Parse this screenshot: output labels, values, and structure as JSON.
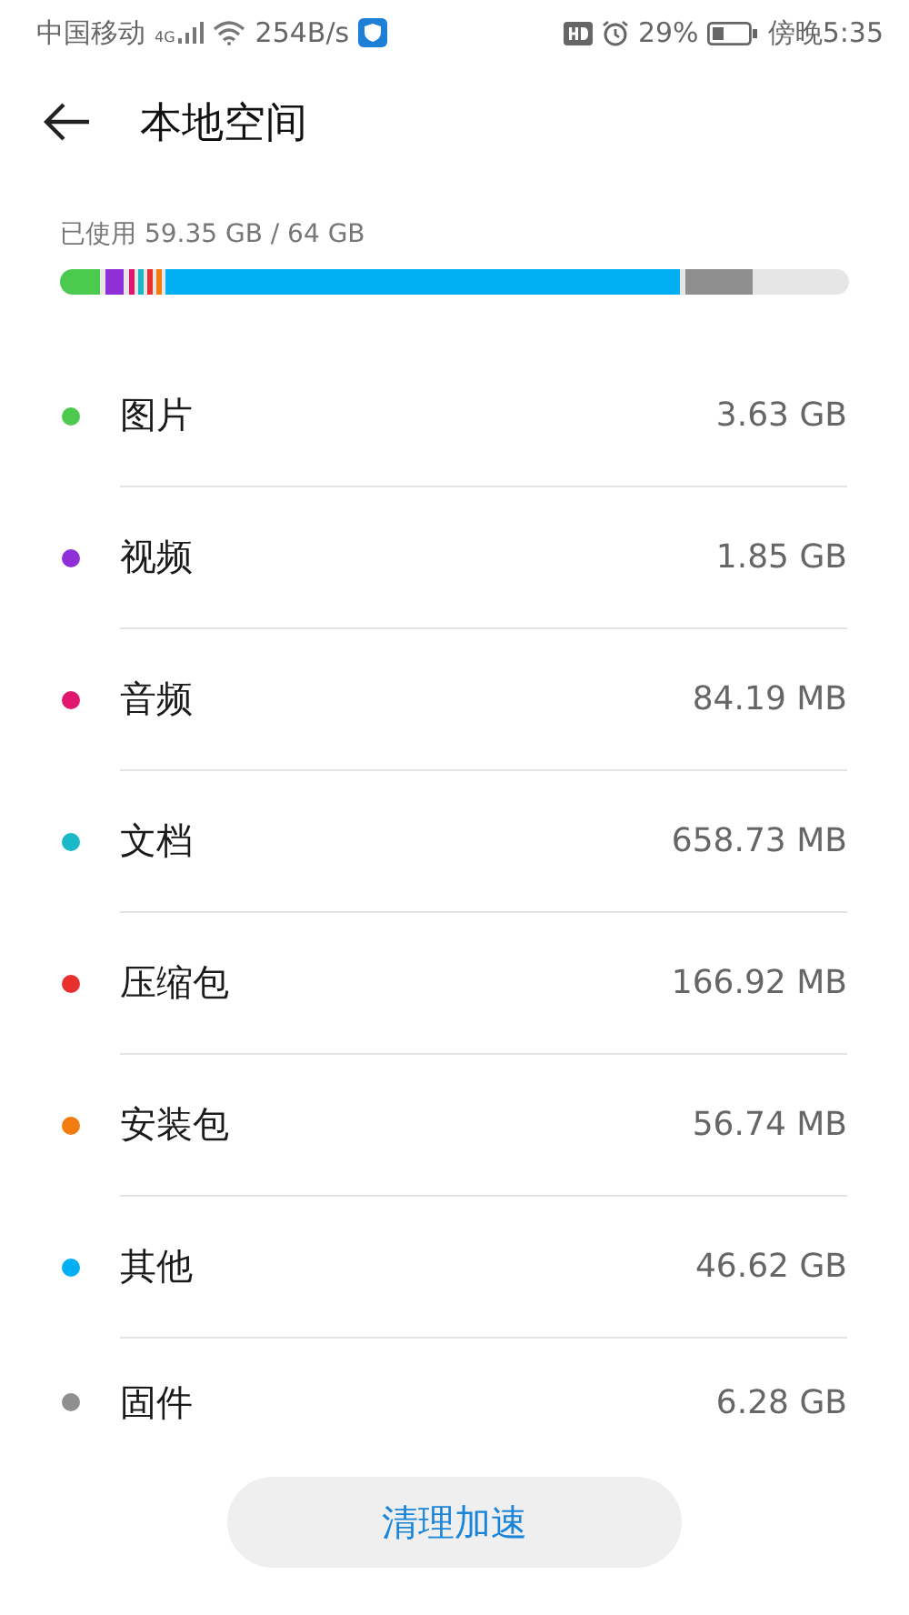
{
  "status_bar": {
    "carrier": "中国移动",
    "network": "4G",
    "speed": "254B/s",
    "battery": "29%",
    "time": "傍晚5:35"
  },
  "header": {
    "title": "本地空间"
  },
  "usage": {
    "label": "已使用 59.35 GB / 64 GB"
  },
  "categories": [
    {
      "name": "图片",
      "size": "3.63 GB",
      "color": "#4cca4f"
    },
    {
      "name": "视频",
      "size": "1.85 GB",
      "color": "#8e2fd8"
    },
    {
      "name": "音频",
      "size": "84.19 MB",
      "color": "#e0166f"
    },
    {
      "name": "文档",
      "size": "658.73 MB",
      "color": "#1bb8c7"
    },
    {
      "name": "压缩包",
      "size": "166.92 MB",
      "color": "#e8302e"
    },
    {
      "name": "安装包",
      "size": "56.74 MB",
      "color": "#f27c10"
    },
    {
      "name": "其他",
      "size": "46.62 GB",
      "color": "#02aff2"
    },
    {
      "name": "固件",
      "size": "6.28 GB",
      "color": "#8f8f8f"
    }
  ],
  "action": {
    "label": "清理加速"
  }
}
